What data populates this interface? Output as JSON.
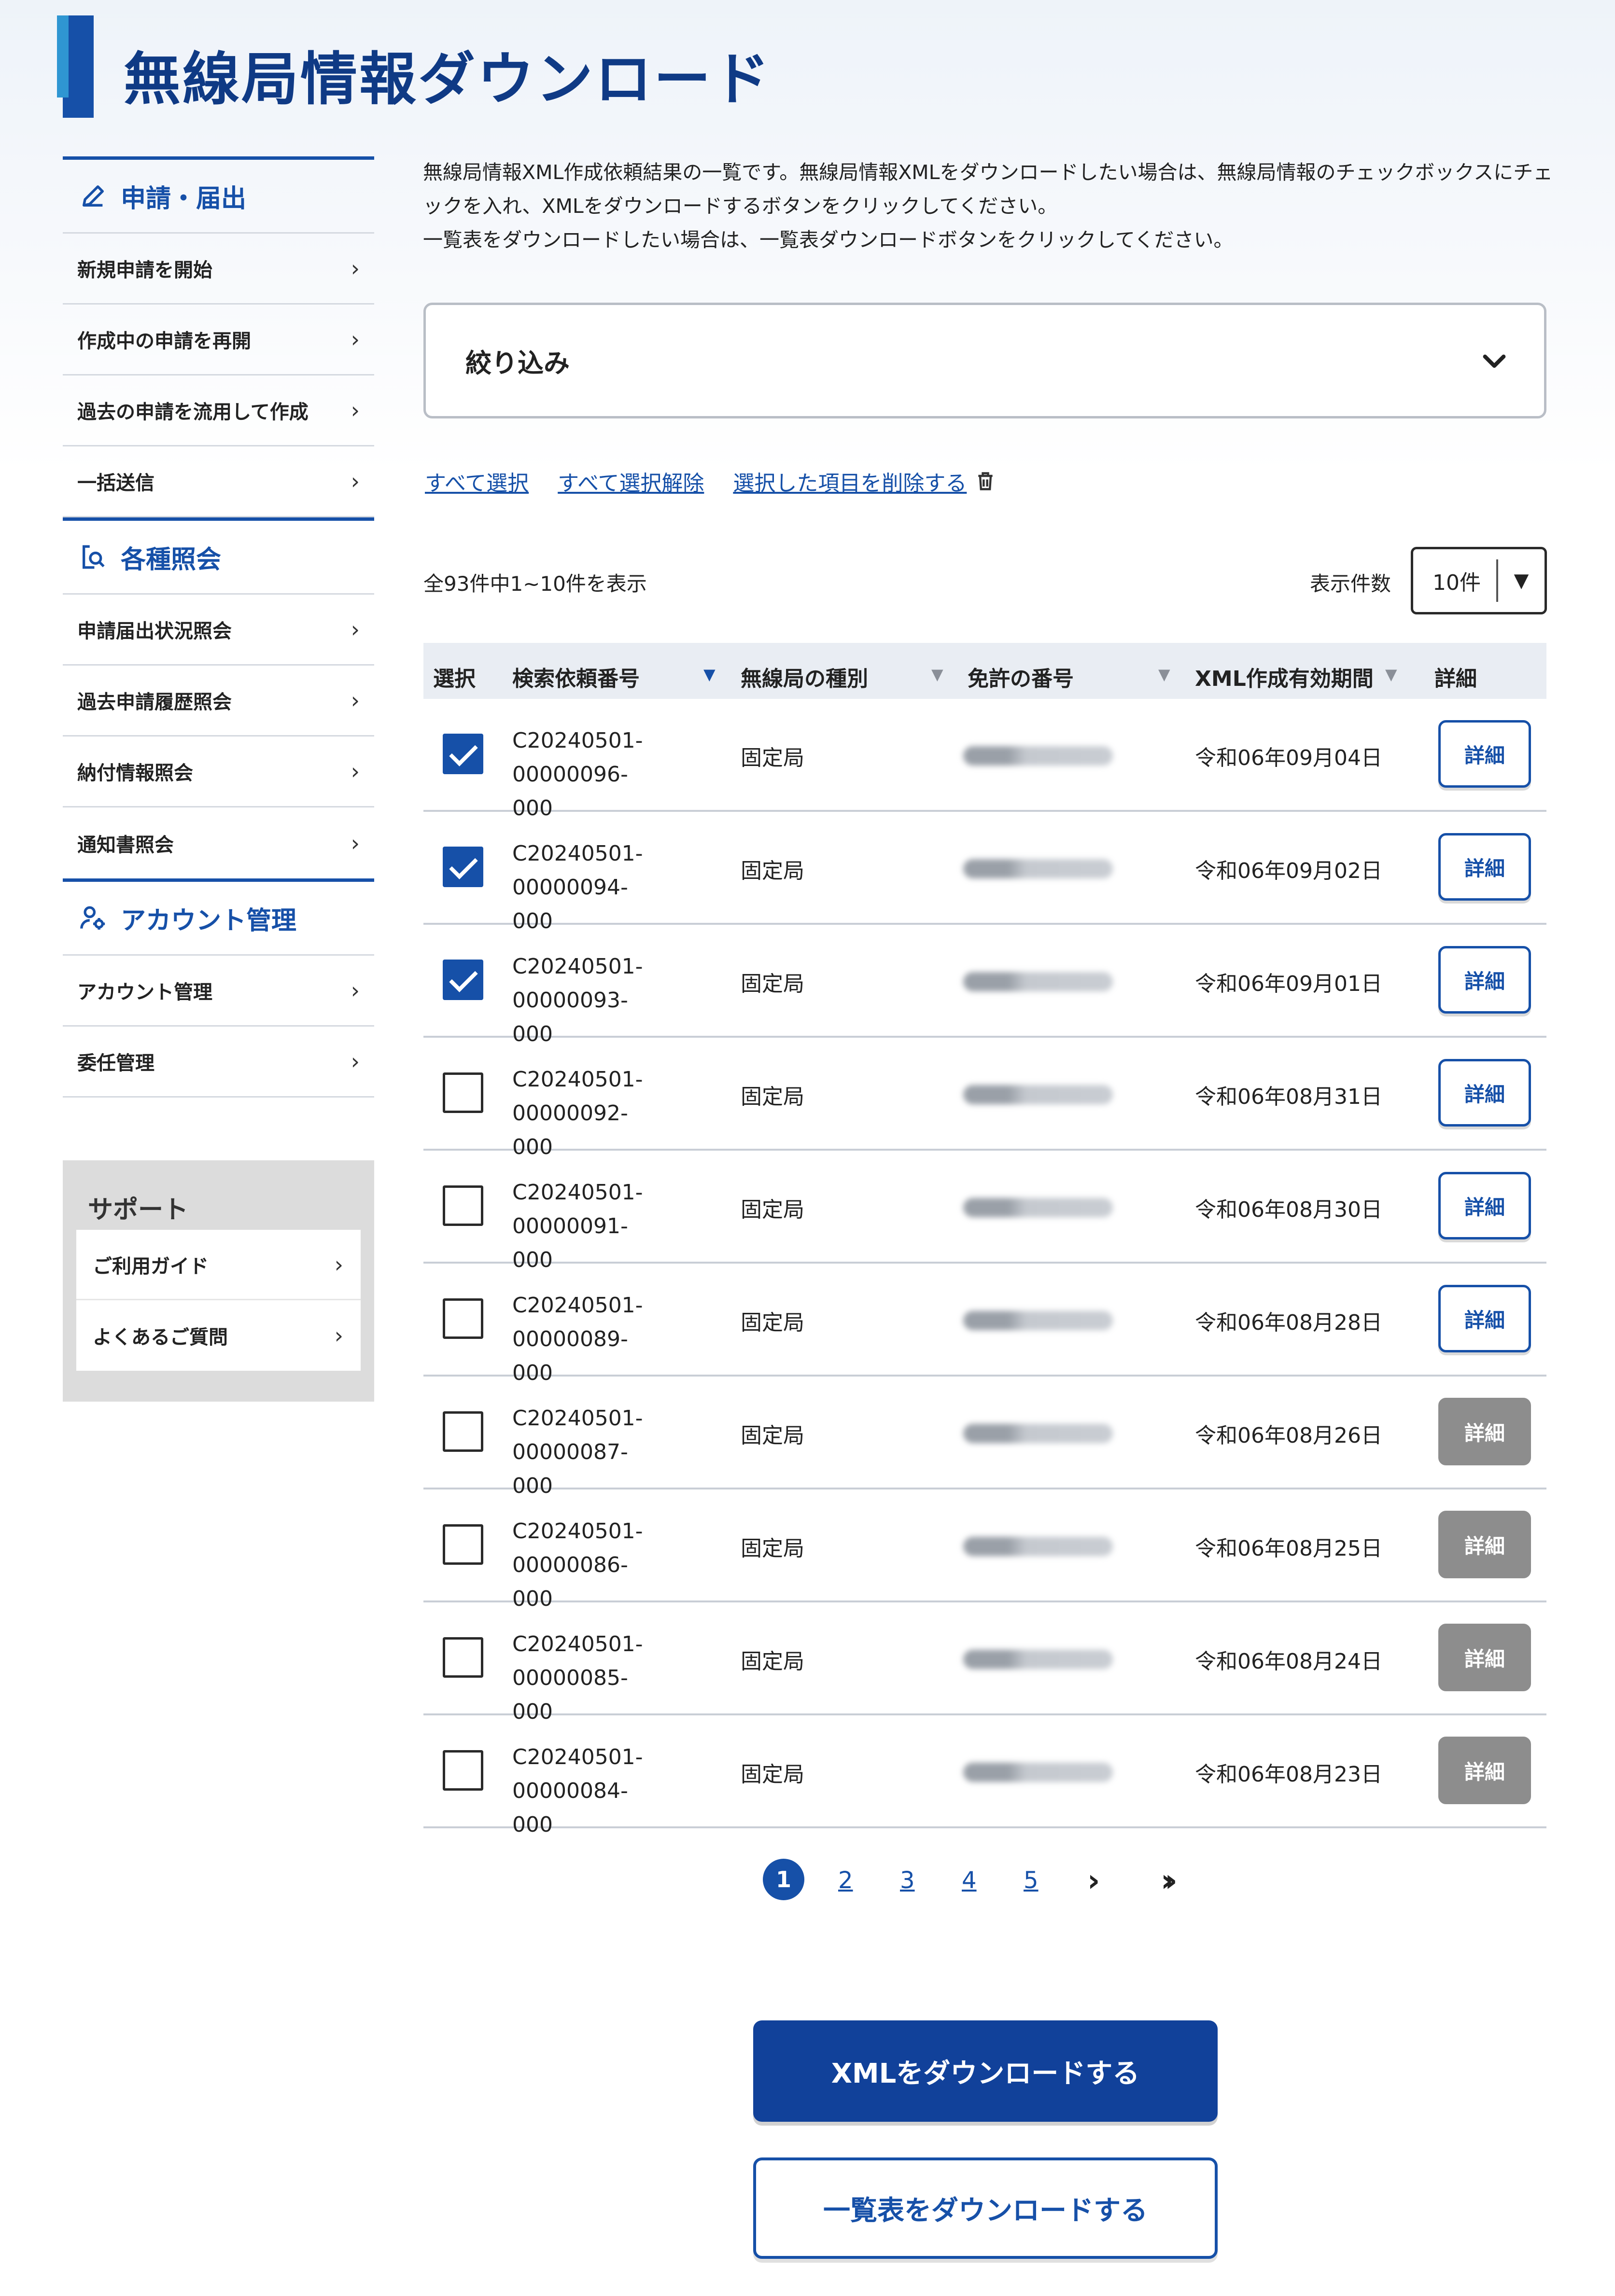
{
  "page": {
    "title": "無線局情報ダウンロード"
  },
  "sidebar": {
    "sections": [
      {
        "heading": "申請・届出",
        "items": [
          "新規申請を開始",
          "作成中の申請を再開",
          "過去の申請を流用して作成",
          "一括送信"
        ]
      },
      {
        "heading": "各種照会",
        "items": [
          "申請届出状況照会",
          "過去申請履歴照会",
          "納付情報照会",
          "通知書照会"
        ]
      },
      {
        "heading": "アカウント管理",
        "items": [
          "アカウント管理",
          "委任管理"
        ]
      }
    ],
    "support": {
      "heading": "サポート",
      "items": [
        "ご利用ガイド",
        "よくあるご質問"
      ]
    }
  },
  "intro": {
    "line1": "無線局情報XML作成依頼結果の一覧です。無線局情報XMLをダウンロードしたい場合は、無線局情報のチェックボックスにチェ",
    "line2": "ックを入れ、XMLをダウンロードするボタンをクリックしてください。",
    "line3": "一覧表をダウンロードしたい場合は、一覧表ダウンロードボタンをクリックしてください。"
  },
  "filter": {
    "label": "絞り込み"
  },
  "selection": {
    "select_all": "すべて選択",
    "deselect_all": "すべて選択解除",
    "delete_selected": "選択した項目を削除する"
  },
  "results": {
    "count_text": "全93件中1~10件を表示",
    "per_page_label": "表示件数",
    "per_page_value": "10件"
  },
  "table": {
    "headers": {
      "select": "選択",
      "search_id": "検索依頼番号",
      "station_type": "無線局の種別",
      "license_no": "免許の番号",
      "xml_period": "XML作成有効期間",
      "detail": "詳細"
    },
    "rows": [
      {
        "checked": true,
        "id_line1": "C20240501-00000096-",
        "id_line2": "000",
        "type": "固定局",
        "date": "令和06年09月04日",
        "detail": "詳細",
        "detail_enabled": true
      },
      {
        "checked": true,
        "id_line1": "C20240501-00000094-",
        "id_line2": "000",
        "type": "固定局",
        "date": "令和06年09月02日",
        "detail": "詳細",
        "detail_enabled": true
      },
      {
        "checked": true,
        "id_line1": "C20240501-00000093-",
        "id_line2": "000",
        "type": "固定局",
        "date": "令和06年09月01日",
        "detail": "詳細",
        "detail_enabled": true
      },
      {
        "checked": false,
        "id_line1": "C20240501-00000092-",
        "id_line2": "000",
        "type": "固定局",
        "date": "令和06年08月31日",
        "detail": "詳細",
        "detail_enabled": true
      },
      {
        "checked": false,
        "id_line1": "C20240501-00000091-",
        "id_line2": "000",
        "type": "固定局",
        "date": "令和06年08月30日",
        "detail": "詳細",
        "detail_enabled": true
      },
      {
        "checked": false,
        "id_line1": "C20240501-00000089-",
        "id_line2": "000",
        "type": "固定局",
        "date": "令和06年08月28日",
        "detail": "詳細",
        "detail_enabled": true
      },
      {
        "checked": false,
        "id_line1": "C20240501-00000087-",
        "id_line2": "000",
        "type": "固定局",
        "date": "令和06年08月26日",
        "detail": "詳細",
        "detail_enabled": false
      },
      {
        "checked": false,
        "id_line1": "C20240501-00000086-",
        "id_line2": "000",
        "type": "固定局",
        "date": "令和06年08月25日",
        "detail": "詳細",
        "detail_enabled": false
      },
      {
        "checked": false,
        "id_line1": "C20240501-00000085-",
        "id_line2": "000",
        "type": "固定局",
        "date": "令和06年08月24日",
        "detail": "詳細",
        "detail_enabled": false
      },
      {
        "checked": false,
        "id_line1": "C20240501-00000084-",
        "id_line2": "000",
        "type": "固定局",
        "date": "令和06年08月23日",
        "detail": "詳細",
        "detail_enabled": false
      }
    ]
  },
  "pagination": {
    "current": "1",
    "pages": [
      "2",
      "3",
      "4",
      "5"
    ]
  },
  "actions": {
    "download_xml": "XMLをダウンロードする",
    "download_list": "一覧表をダウンロードする"
  },
  "colors": {
    "primary": "#1650a8",
    "accent": "#2f96d2",
    "disabled": "#8d8d8d"
  }
}
